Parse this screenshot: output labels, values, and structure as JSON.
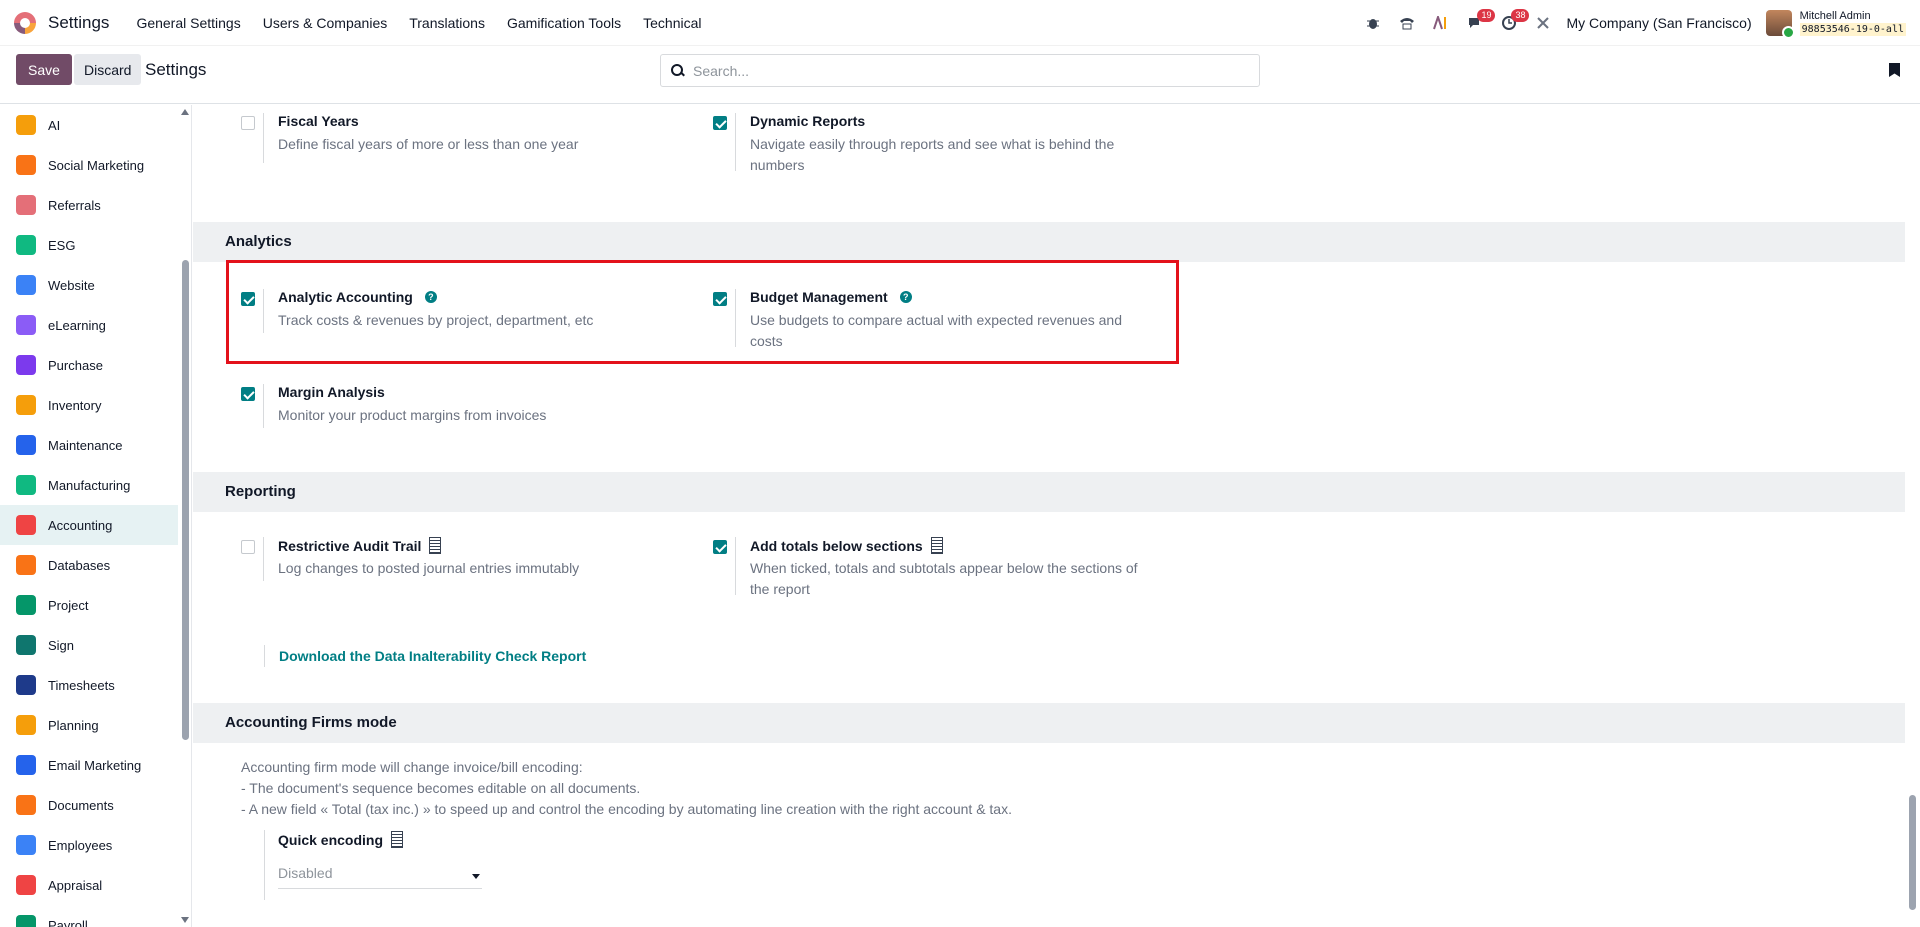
{
  "navbar": {
    "app_title": "Settings",
    "menu": [
      "General Settings",
      "Users & Companies",
      "Translations",
      "Gamification Tools",
      "Technical"
    ],
    "messages_badge": "19",
    "activities_badge": "38",
    "company": "My Company (San Francisco)",
    "user_name": "Mitchell Admin",
    "db_name": "98853546-19-0-all"
  },
  "control": {
    "save_label": "Save",
    "discard_label": "Discard",
    "title": "Settings",
    "search_placeholder": "Search..."
  },
  "sidebar": {
    "items": [
      {
        "label": "AI",
        "color": "#f59e0b"
      },
      {
        "label": "Social Marketing",
        "color": "#f97316"
      },
      {
        "label": "Referrals",
        "color": "#e46f78"
      },
      {
        "label": "ESG",
        "color": "#10b981"
      },
      {
        "label": "Website",
        "color": "#3b82f6"
      },
      {
        "label": "eLearning",
        "color": "#8b5cf6"
      },
      {
        "label": "Purchase",
        "color": "#7c3aed"
      },
      {
        "label": "Inventory",
        "color": "#f59e0b"
      },
      {
        "label": "Maintenance",
        "color": "#2563eb"
      },
      {
        "label": "Manufacturing",
        "color": "#10b981"
      },
      {
        "label": "Accounting",
        "color": "#ef4444",
        "active": true
      },
      {
        "label": "Databases",
        "color": "#f97316"
      },
      {
        "label": "Project",
        "color": "#059669"
      },
      {
        "label": "Sign",
        "color": "#0f766e"
      },
      {
        "label": "Timesheets",
        "color": "#1e3a8a"
      },
      {
        "label": "Planning",
        "color": "#f59e0b"
      },
      {
        "label": "Email Marketing",
        "color": "#2563eb"
      },
      {
        "label": "Documents",
        "color": "#f97316"
      },
      {
        "label": "Employees",
        "color": "#3b82f6"
      },
      {
        "label": "Appraisal",
        "color": "#ef4444"
      },
      {
        "label": "Payroll",
        "color": "#059669"
      }
    ]
  },
  "settings": {
    "fiscal_years": {
      "title": "Fiscal Years",
      "desc": "Define fiscal years of more or less than one year",
      "checked": false
    },
    "dynamic_reports": {
      "title": "Dynamic Reports",
      "desc_1": "Navigate easily through reports and see what is behind the",
      "desc_2": "numbers",
      "checked": true
    },
    "analytics_header": "Analytics",
    "analytic_accounting": {
      "title": "Analytic Accounting",
      "desc": "Track costs & revenues by project, department, etc",
      "checked": true
    },
    "budget_management": {
      "title": "Budget Management",
      "desc_1": "Use budgets to compare actual with expected revenues and",
      "desc_2": "costs",
      "checked": true
    },
    "margin_analysis": {
      "title": "Margin Analysis",
      "desc": "Monitor your product margins from invoices",
      "checked": true
    },
    "reporting_header": "Reporting",
    "restrictive_audit": {
      "title": "Restrictive Audit Trail",
      "desc": "Log changes to posted journal entries immutably",
      "checked": false
    },
    "add_totals": {
      "title": "Add totals below sections",
      "desc_1": "When ticked, totals and subtotals appear below the sections of",
      "desc_2": "the report",
      "checked": true
    },
    "download_link": "Download the Data Inalterability Check Report",
    "firms_header": "Accounting Firms mode",
    "firm_line_1": "Accounting firm mode will change invoice/bill encoding:",
    "firm_line_2": "- The document's sequence becomes editable on all documents.",
    "firm_line_3": "- A new field « Total (tax inc.) » to speed up and control the encoding by automating line creation with the right account & tax.",
    "quick_encoding": {
      "title": "Quick encoding",
      "value": "Disabled"
    }
  }
}
